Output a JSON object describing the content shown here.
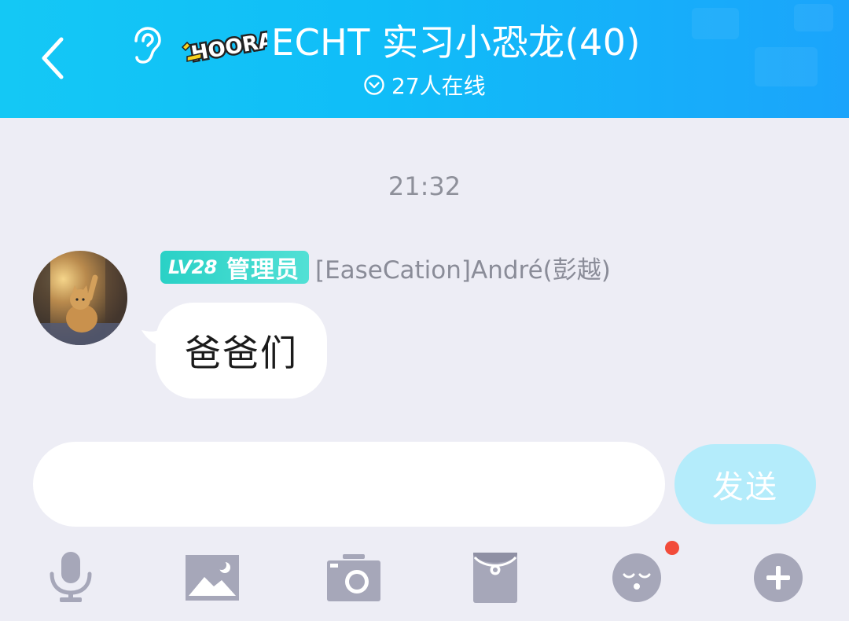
{
  "header": {
    "back_icon": "chevron-left-icon",
    "listen_icon": "ear-icon",
    "logo_text": "HOORAY",
    "title": "ECHT 实习小恐龙(40)",
    "online_icon": "chevron-down-circle-icon",
    "online_text": "27人在线"
  },
  "chat": {
    "timestamp": "21:32",
    "messages": [
      {
        "level": "LV28",
        "role": "管理员",
        "sender": "[EaseCation]André(彭越)",
        "text": "爸爸们"
      }
    ]
  },
  "input": {
    "value": "",
    "placeholder": "",
    "send_label": "发送"
  },
  "toolbar": {
    "items": [
      {
        "icon": "microphone-icon"
      },
      {
        "icon": "image-icon"
      },
      {
        "icon": "camera-icon"
      },
      {
        "icon": "red-packet-icon"
      },
      {
        "icon": "emoji-icon",
        "notification_dot": true
      },
      {
        "icon": "plus-icon"
      }
    ]
  },
  "colors": {
    "header_start": "#14c8f5",
    "header_end": "#1ba4fb",
    "background": "#ededf5",
    "badge": "#2ad1c6",
    "send_button": "#b4ecfb",
    "icon_gray": "#a6a7b9",
    "notification": "#f24b3a"
  }
}
